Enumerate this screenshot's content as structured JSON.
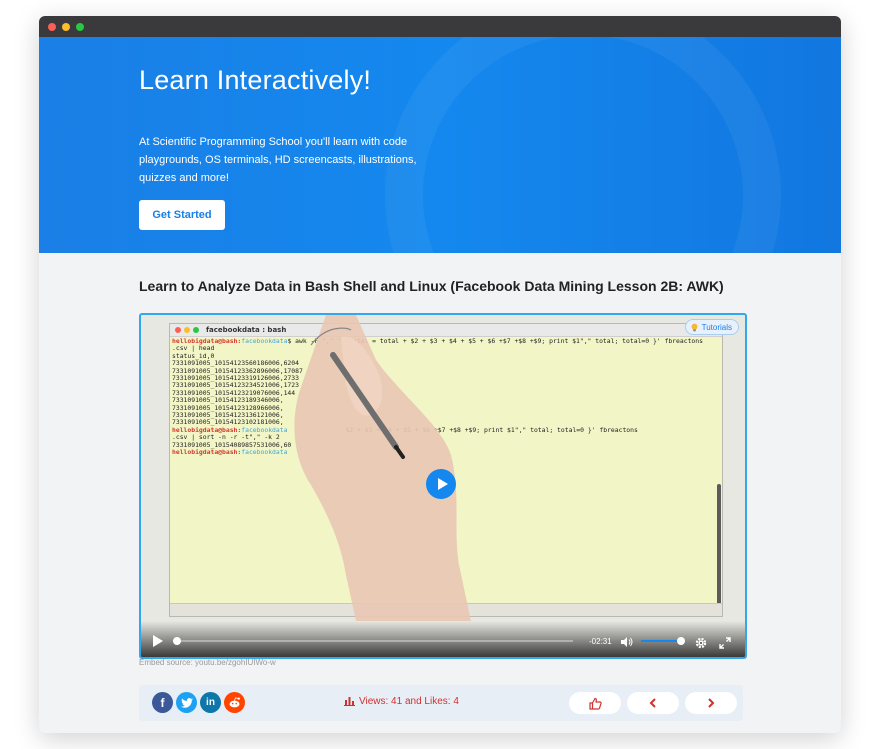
{
  "hero": {
    "title": "Learn Interactively!",
    "text": "At Scientific Programming School you'll learn with code playgrounds, OS terminals, HD screencasts, illustrations, quizzes and more!",
    "cta_label": "Get Started"
  },
  "lesson": {
    "title": "Learn to Analyze Data in Bash Shell and Linux (Facebook Data Mining Lesson 2B: AWK)"
  },
  "video": {
    "terminal_title": "facebookdata : bash",
    "prompt_user": "hellobigdata@bash:",
    "prompt_path": "facebookdata",
    "command_1": "$ awk -F \",\" '{ total = total + $2 + $3 + $4 + $5 + $6 +$7 +$8 +$9; print $1\",\" total; total=0 }' fbreactons",
    "command_1b": ".csv | head",
    "output_lines": [
      "status_id,0",
      "7331091005_10154123560186006,6204",
      "7331091005_10154123362896006,17087",
      "7331091005_10154123319126006,2733",
      "7331091005_10154123234521006,1723",
      "7331091005_10154123219076006,144",
      "7331091005_10154123189346006,",
      "7331091005_10154123128966006,",
      "7331091005_10154123136121006,",
      "7331091005_10154123102181006,"
    ],
    "command_2_tail": "$2 + $3 + $4 + $5 + $6 +$7 +$8 +$9; print $1\",\" total; total=0 }' fbreactons",
    "command_2b": ".csv | sort -n -r -t\",\" -k 2",
    "output_2": "7331091005_10154089857531006,60",
    "tutorials_label": "Tutorials",
    "time_left": "-02:31",
    "embed_source": "Embed source: youtu.be/zgohIUIWo-w"
  },
  "bottom": {
    "views_text": "Views: 41 and Likes: 4"
  },
  "colors": {
    "brand": "#1a7fe6",
    "accent_red": "#d0312d"
  }
}
